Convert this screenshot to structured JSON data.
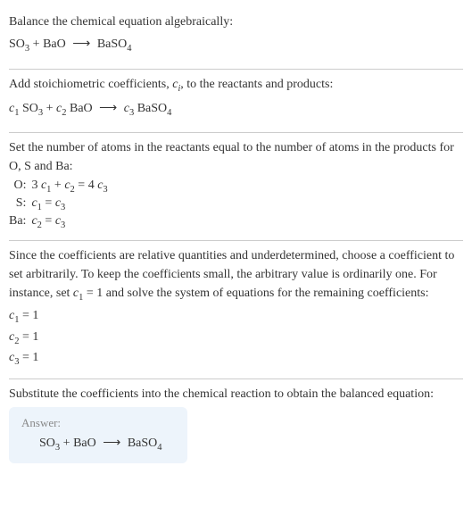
{
  "section1": {
    "text": "Balance the chemical equation algebraically:",
    "reactant1": "SO",
    "reactant1_sub": "3",
    "plus1": " + ",
    "reactant2": "BaO",
    "arrow": "⟶",
    "product1": "BaSO",
    "product1_sub": "4"
  },
  "section2": {
    "text_a": "Add stoichiometric coefficients, ",
    "ci_c": "c",
    "ci_i": "i",
    "text_b": ", to the reactants and products:",
    "c1_c": "c",
    "c1_n": "1",
    "r1": " SO",
    "r1_sub": "3",
    "plus": " + ",
    "c2_c": "c",
    "c2_n": "2",
    "r2": " BaO",
    "arrow": "⟶",
    "c3_c": "c",
    "c3_n": "3",
    "p1": " BaSO",
    "p1_sub": "4"
  },
  "section3": {
    "text": "Set the number of atoms in the reactants equal to the number of atoms in the products for O, S and Ba:",
    "rows": [
      {
        "el": "O:",
        "lhs_a": "3 ",
        "lhs_c1c": "c",
        "lhs_c1n": "1",
        "lhs_plus": " + ",
        "lhs_c2c": "c",
        "lhs_c2n": "2",
        "eq": " = ",
        "rhs_a": "4 ",
        "rhs_cc": "c",
        "rhs_cn": "3"
      },
      {
        "el": "S:",
        "lhs_cc": "c",
        "lhs_cn": "1",
        "eq": " = ",
        "rhs_cc": "c",
        "rhs_cn": "3"
      },
      {
        "el": "Ba:",
        "lhs_cc": "c",
        "lhs_cn": "2",
        "eq": " = ",
        "rhs_cc": "c",
        "rhs_cn": "3"
      }
    ]
  },
  "section4": {
    "text_a": "Since the coefficients are relative quantities and underdetermined, choose a coefficient to set arbitrarily. To keep the coefficients small, the arbitrary value is ordinarily one. For instance, set ",
    "set_c": "c",
    "set_n": "1",
    "text_b": " = 1 and solve the system of equations for the remaining coefficients:",
    "coeffs": [
      {
        "cc": "c",
        "cn": "1",
        "val": " = 1"
      },
      {
        "cc": "c",
        "cn": "2",
        "val": " = 1"
      },
      {
        "cc": "c",
        "cn": "3",
        "val": " = 1"
      }
    ]
  },
  "section5": {
    "text": "Substitute the coefficients into the chemical reaction to obtain the balanced equation:",
    "answer_label": "Answer:",
    "reactant1": "SO",
    "reactant1_sub": "3",
    "plus1": " + ",
    "reactant2": "BaO",
    "arrow": "⟶",
    "product1": "BaSO",
    "product1_sub": "4"
  }
}
